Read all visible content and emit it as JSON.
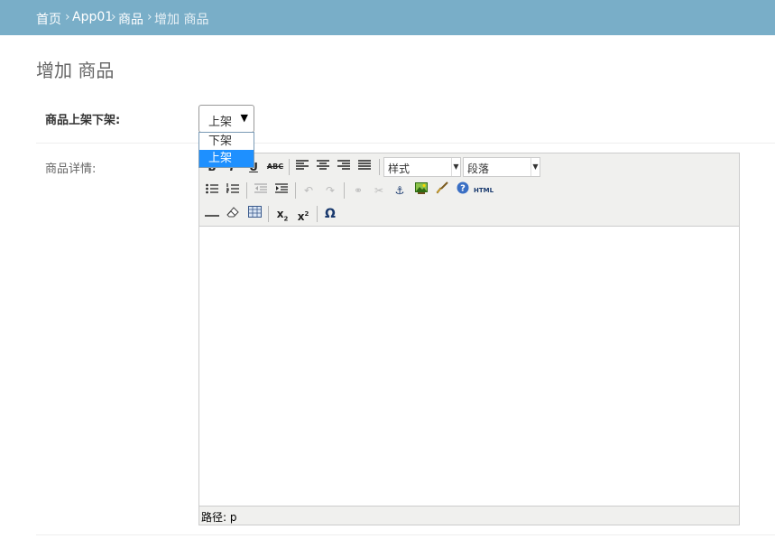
{
  "breadcrumb": {
    "home": "首页",
    "app": "App01",
    "model": "商品",
    "current": "增加 商品",
    "separator": "›"
  },
  "page": {
    "title": "增加 商品"
  },
  "form": {
    "status_label": "商品上架下架:",
    "status_selected": "上架",
    "status_options": [
      "下架",
      "上架"
    ],
    "detail_label": "商品详情:"
  },
  "editor": {
    "style_select": "样式",
    "format_select": "段落",
    "html_button": "HTML",
    "path_label": "路径: p"
  }
}
